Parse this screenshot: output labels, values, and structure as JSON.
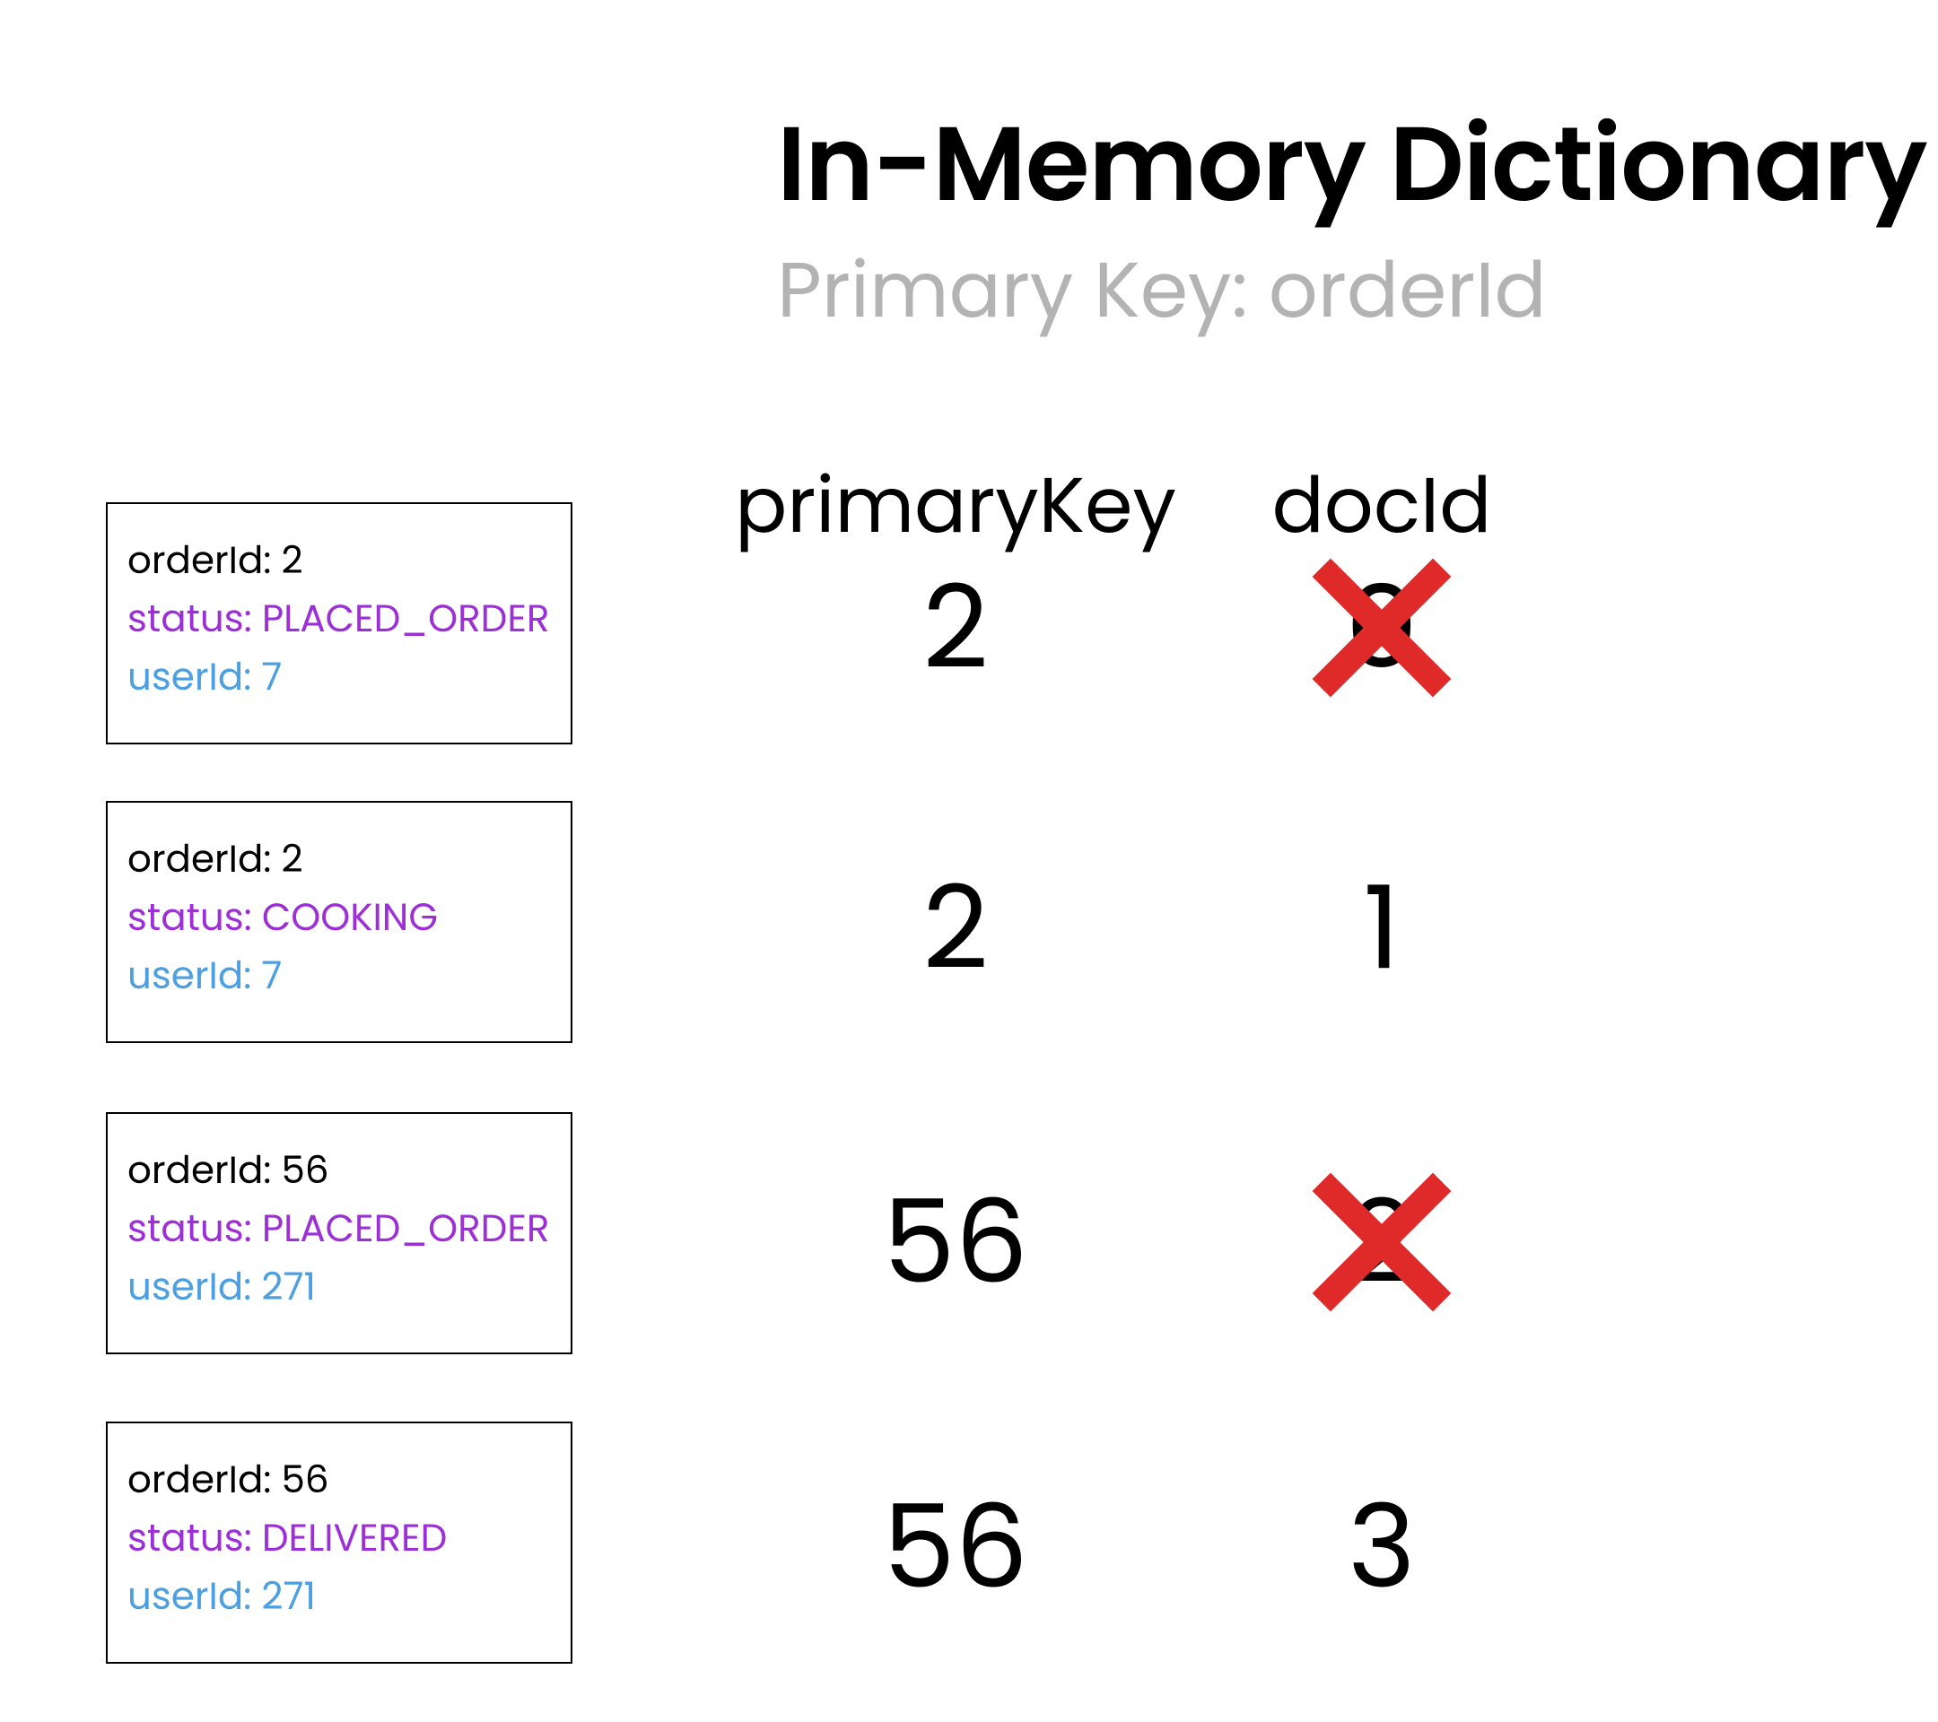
{
  "title": "In-Memory Dictionary",
  "subtitle": "Primary Key: orderId",
  "headers": {
    "pk": "primaryKey",
    "doc": "docId"
  },
  "labels": {
    "order": "orderId: ",
    "status": "status: ",
    "user": "userId: "
  },
  "cards": [
    {
      "orderId": "2",
      "status": "PLACED_ORDER",
      "userId": "7"
    },
    {
      "orderId": "2",
      "status": "COOKING",
      "userId": "7"
    },
    {
      "orderId": "56",
      "status": "PLACED_ORDER",
      "userId": "271"
    },
    {
      "orderId": "56",
      "status": "DELIVERED",
      "userId": "271"
    }
  ],
  "rows": [
    {
      "pk": "2",
      "doc": "0",
      "crossed": true
    },
    {
      "pk": "2",
      "doc": "1",
      "crossed": false
    },
    {
      "pk": "56",
      "doc": "2",
      "crossed": true
    },
    {
      "pk": "56",
      "doc": "3",
      "crossed": false
    }
  ],
  "card_tops": [
    560,
    893,
    1240,
    1585
  ],
  "row_ys": [
    700,
    1035,
    1385,
    1725
  ],
  "col_x": {
    "pk": 1065,
    "doc": 1540
  }
}
